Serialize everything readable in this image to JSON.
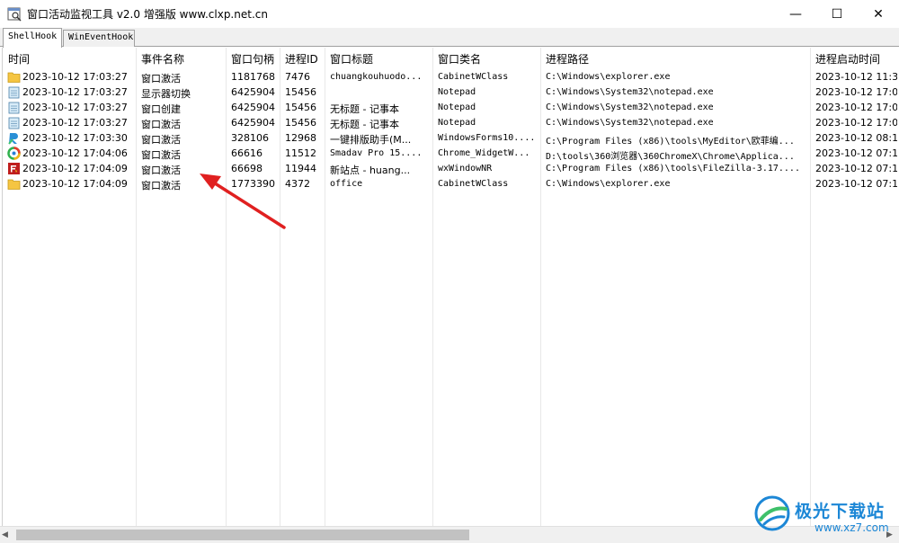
{
  "window": {
    "title": "窗口活动监视工具 v2.0 增强版 www.clxp.net.cn",
    "app_icon": "magnifier-window-icon",
    "controls": {
      "minimize": "—",
      "maximize": "☐",
      "close": "✕"
    }
  },
  "tabs": [
    {
      "label": "ShellHook",
      "active": true
    },
    {
      "label": "WinEventHook",
      "active": false
    }
  ],
  "table": {
    "columns": [
      "时间",
      "事件名称",
      "窗口句柄",
      "进程ID",
      "窗口标题",
      "窗口类名",
      "进程路径",
      "进程启动时间"
    ],
    "rows": [
      {
        "icon": "folder-icon",
        "time": "2023-10-12 17:03:27",
        "event": "窗口激活",
        "handle": "1181768",
        "pid": "7476",
        "title": "chuangkouhuodo...",
        "class": "CabinetWClass",
        "path": "C:\\Windows\\explorer.exe",
        "start": "2023-10-12 11:3"
      },
      {
        "icon": "notepad-icon",
        "time": "2023-10-12 17:03:27",
        "event": "显示器切换",
        "handle": "6425904",
        "pid": "15456",
        "title": "",
        "class": "Notepad",
        "path": "C:\\Windows\\System32\\notepad.exe",
        "start": "2023-10-12 17:0"
      },
      {
        "icon": "notepad-icon",
        "time": "2023-10-12 17:03:27",
        "event": "窗口创建",
        "handle": "6425904",
        "pid": "15456",
        "title": "无标题 - 记事本",
        "class": "Notepad",
        "path": "C:\\Windows\\System32\\notepad.exe",
        "start": "2023-10-12 17:0"
      },
      {
        "icon": "notepad-icon",
        "time": "2023-10-12 17:03:27",
        "event": "窗口激活",
        "handle": "6425904",
        "pid": "15456",
        "title": "无标题 - 记事本",
        "class": "Notepad",
        "path": "C:\\Windows\\System32\\notepad.exe",
        "start": "2023-10-12 17:0"
      },
      {
        "icon": "editor-r-icon",
        "time": "2023-10-12 17:03:30",
        "event": "窗口激活",
        "handle": "328106",
        "pid": "12968",
        "title": "一键排版助手(M...",
        "class": "WindowsForms10....",
        "path": "C:\\Program Files (x86)\\tools\\MyEditor\\欧菲编...",
        "start": "2023-10-12 08:1"
      },
      {
        "icon": "browser-360-icon",
        "time": "2023-10-12 17:04:06",
        "event": "窗口激活",
        "handle": "66616",
        "pid": "11512",
        "title": "Smadav Pro 15....",
        "class": "Chrome_WidgetW...",
        "path": "D:\\tools\\360浏览器\\360ChromeX\\Chrome\\Applica...",
        "start": "2023-10-12 07:1"
      },
      {
        "icon": "filezilla-icon",
        "time": "2023-10-12 17:04:09",
        "event": "窗口激活",
        "handle": "66698",
        "pid": "11944",
        "title": "新站点 - huang...",
        "class": "wxWindowNR",
        "path": "C:\\Program Files (x86)\\tools\\FileZilla-3.17....",
        "start": "2023-10-12 07:1"
      },
      {
        "icon": "folder-icon",
        "time": "2023-10-12 17:04:09",
        "event": "窗口激活",
        "handle": "1773390",
        "pid": "4372",
        "title": "office",
        "class": "CabinetWClass",
        "path": "C:\\Windows\\explorer.exe",
        "start": "2023-10-12 07:1"
      }
    ]
  },
  "scrollbar": {
    "left_arrow": "◀",
    "right_arrow": "▶"
  },
  "watermark": {
    "text": "极光下载站",
    "url": "www.xz7.com"
  },
  "colors": {
    "accent": "#1c87d6",
    "arrow": "#e02020"
  }
}
